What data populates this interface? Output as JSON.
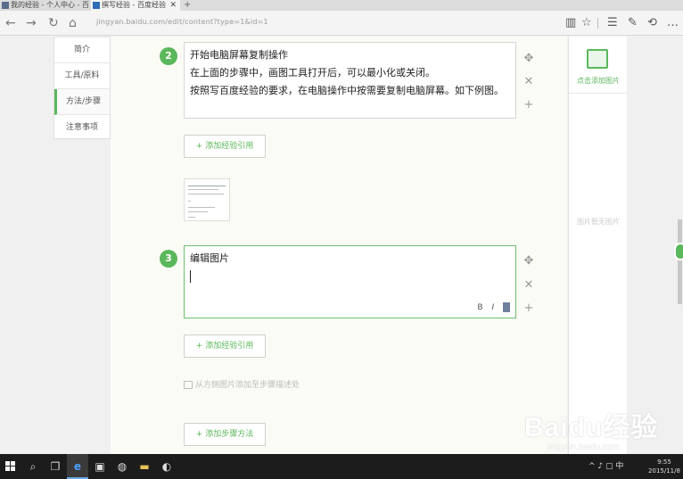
{
  "browser": {
    "tabs": [
      {
        "title": "我的经验 - 个人中心 - 百度经验",
        "close": ""
      },
      {
        "title": "撰写经验 - 百度经验",
        "close": "✕"
      }
    ],
    "new_tab": "+",
    "back": "←",
    "forward": "→",
    "refresh": "↻",
    "home": "⌂",
    "url": "jingyan.baidu.com/edit/content?type=1&id=1",
    "toolbar": {
      "reading": "▥",
      "favorite": "☆",
      "hub": "☰",
      "note": "✎",
      "share": "⟲",
      "more": "…"
    }
  },
  "sidebar": {
    "items": [
      {
        "label": "简介"
      },
      {
        "label": "工具/原料"
      },
      {
        "label": "方法/步骤"
      },
      {
        "label": "注意事项"
      }
    ]
  },
  "steps": [
    {
      "number": "2",
      "lines": [
        "开始电脑屏幕复制操作",
        "在上面的步骤中，画图工具打开后，可以最小化或关闭。",
        "按照写百度经验的要求，在电脑操作中按需要复制电脑屏幕。如下例图。"
      ],
      "add_ref_label": "+ 添加经验引用"
    },
    {
      "number": "3",
      "lines": [
        "编辑图片"
      ],
      "add_ref_label": "+ 添加经验引用",
      "format": {
        "bold": "B",
        "italic": "I"
      }
    }
  ],
  "controls": {
    "move": "✥",
    "delete": "✕",
    "add": "+"
  },
  "upload_hint": "从方侧图片添加至步骤描述处",
  "add_step_label": "+ 添加步骤方法",
  "right_panel": {
    "add_image_label": "点击添加图片",
    "hint": "图片暂无图片"
  },
  "watermark": {
    "logo": "Baidu经验",
    "url": "jingyan.baidu.com"
  },
  "taskbar": {
    "search": "⌕",
    "taskview": "❐",
    "tray": "^ ♪ ▢ 中",
    "time": "9:55",
    "date": "2015/11/8"
  },
  "colors": {
    "accent": "#5bb75b",
    "taskbar": "#1c1c1c"
  }
}
